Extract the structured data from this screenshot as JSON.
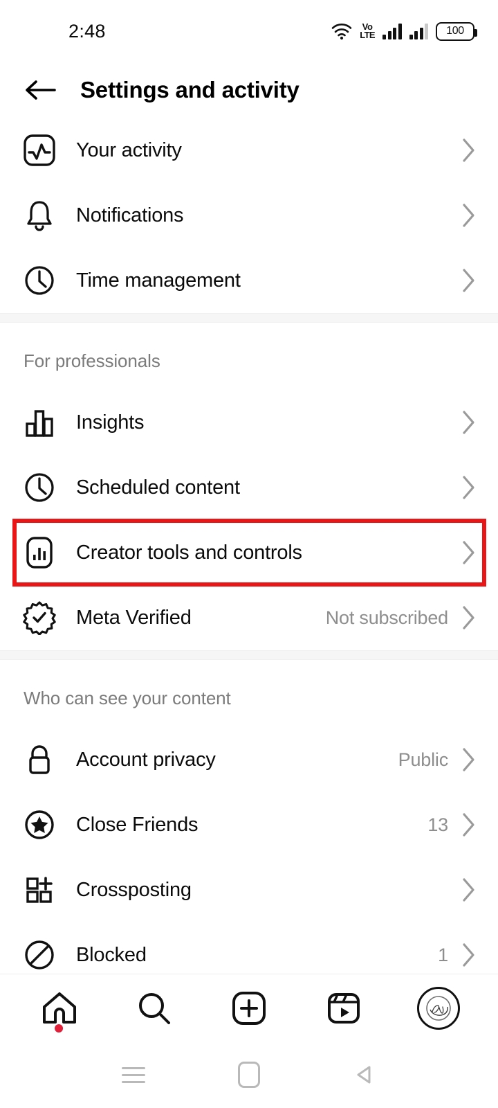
{
  "status_bar": {
    "time": "2:48",
    "wifi_icon": "wifi-icon",
    "volte_line1": "Vo",
    "volte_line2": "LTE",
    "signal_icon_1": "signal-bars-icon",
    "signal_icon_2": "signal-bars-icon",
    "battery_level": "100"
  },
  "header": {
    "back_icon": "back-arrow-icon",
    "title": "Settings and activity"
  },
  "sections": [
    {
      "title": null,
      "items": [
        {
          "icon": "activity-chart-icon",
          "label": "Your activity",
          "value": null
        },
        {
          "icon": "bell-icon",
          "label": "Notifications",
          "value": null
        },
        {
          "icon": "clock-icon",
          "label": "Time management",
          "value": null
        }
      ]
    },
    {
      "title": "For professionals",
      "items": [
        {
          "icon": "bar-chart-icon",
          "label": "Insights",
          "value": null
        },
        {
          "icon": "clock-icon",
          "label": "Scheduled content",
          "value": null
        },
        {
          "icon": "creator-tools-icon",
          "label": "Creator tools and controls",
          "value": null,
          "highlighted": true
        },
        {
          "icon": "verified-badge-icon",
          "label": "Meta Verified",
          "value": "Not subscribed"
        }
      ]
    },
    {
      "title": "Who can see your content",
      "items": [
        {
          "icon": "lock-icon",
          "label": "Account privacy",
          "value": "Public"
        },
        {
          "icon": "star-circle-icon",
          "label": "Close Friends",
          "value": "13"
        },
        {
          "icon": "crossposting-grid-plus-icon",
          "label": "Crossposting",
          "value": null
        },
        {
          "icon": "blocked-circle-slash-icon",
          "label": "Blocked",
          "value": "1"
        }
      ]
    }
  ],
  "chevron_icon": "chevron-right-icon",
  "bottom_nav": [
    {
      "icon": "home-icon",
      "badge": true
    },
    {
      "icon": "search-icon",
      "badge": false
    },
    {
      "icon": "create-plus-icon",
      "badge": false
    },
    {
      "icon": "reels-icon",
      "badge": false
    },
    {
      "icon": "profile-avatar",
      "badge": false
    }
  ],
  "android_nav": [
    {
      "icon": "recents-icon"
    },
    {
      "icon": "home-square-icon"
    },
    {
      "icon": "back-triangle-icon"
    }
  ],
  "colors": {
    "accent_red": "#e81616",
    "badge_red": "#e2203a",
    "muted_text": "#8e8e8e",
    "section_title": "#7b7b7b",
    "divider": "#f6f6f6"
  }
}
